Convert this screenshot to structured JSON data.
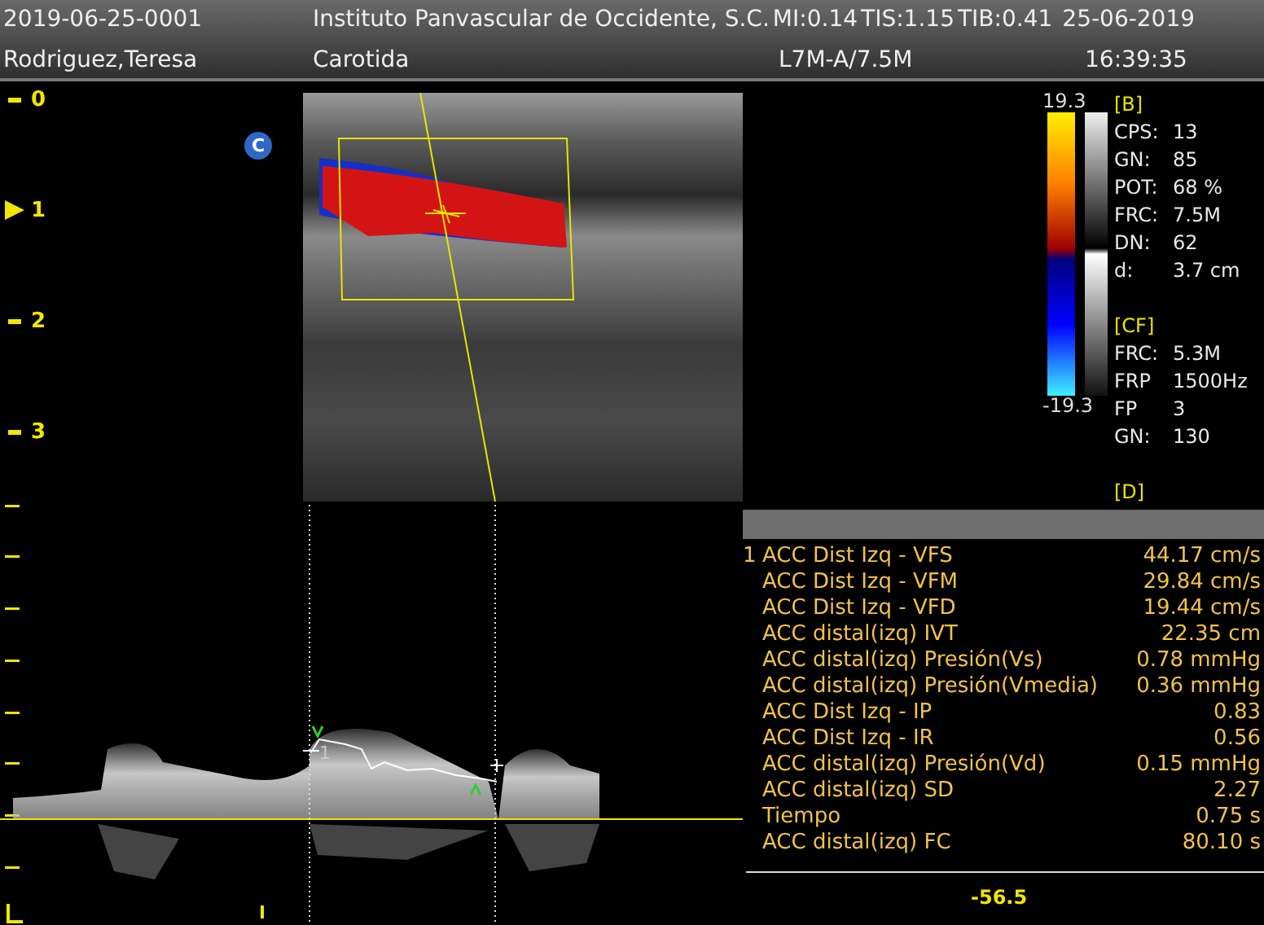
{
  "header": {
    "study_id": "2019-06-25-0001",
    "patient": "Rodriguez,Teresa",
    "institution": "Instituto Panvascular de Occidente, S.C.",
    "exam": "Carotida",
    "indices": [
      "MI:0.14",
      "TIS:1.15",
      "TIB:0.41"
    ],
    "probe": "L7M-A/7.5M",
    "date": "25-06-2019",
    "time": "16:39:35"
  },
  "depth_scale": [
    {
      "label": "0",
      "selected": false
    },
    {
      "label": "1",
      "selected": true
    },
    {
      "label": "2",
      "selected": false
    },
    {
      "label": "3",
      "selected": false
    }
  ],
  "mode_badge": "C",
  "color_scale": {
    "max": "19.3",
    "min": "-19.3"
  },
  "parameters": [
    {
      "title": "[B]",
      "rows": [
        {
          "name": "CPS:",
          "value": "13"
        },
        {
          "name": "GN:",
          "value": "85"
        },
        {
          "name": "POT:",
          "value": "68 %"
        },
        {
          "name": "FRC:",
          "value": "7.5M"
        },
        {
          "name": "DN:",
          "value": "62"
        },
        {
          "name": "d:",
          "value": "3.7 cm"
        }
      ]
    },
    {
      "title": "[CF]",
      "rows": [
        {
          "name": "FRC:",
          "value": "5.3M"
        },
        {
          "name": "FRP",
          "value": "1500Hz"
        },
        {
          "name": "FP",
          "value": "3"
        },
        {
          "name": "GN:",
          "value": "130"
        }
      ]
    },
    {
      "title": "[D]"
    }
  ],
  "spectrum": {
    "cursor_label": "1"
  },
  "measurements": [
    {
      "index": "1",
      "label": "ACC Dist Izq - VFS",
      "value": "44.17 cm/s"
    },
    {
      "label": "ACC Dist Izq - VFM",
      "value": "29.84 cm/s"
    },
    {
      "label": "ACC Dist Izq - VFD",
      "value": "19.44 cm/s"
    },
    {
      "label": "ACC distal(izq) IVT",
      "value": "22.35 cm"
    },
    {
      "label": "ACC distal(izq) Presión(Vs)",
      "value": "0.78 mmHg"
    },
    {
      "label": "ACC distal(izq) Presión(Vmedia)",
      "value": "0.36 mmHg"
    },
    {
      "label": "ACC Dist Izq - IP",
      "value": "0.83"
    },
    {
      "label": "ACC Dist Izq - IR",
      "value": "0.56"
    },
    {
      "label": "ACC distal(izq) Presión(Vd)",
      "value": "0.15 mmHg"
    },
    {
      "label": "ACC distal(izq) SD",
      "value": "2.27"
    },
    {
      "label": "Tiempo",
      "value": "0.75 s"
    },
    {
      "label": "ACC distal(izq) FC",
      "value": "80.10 s"
    }
  ],
  "baseline_reading": "-56.5"
}
